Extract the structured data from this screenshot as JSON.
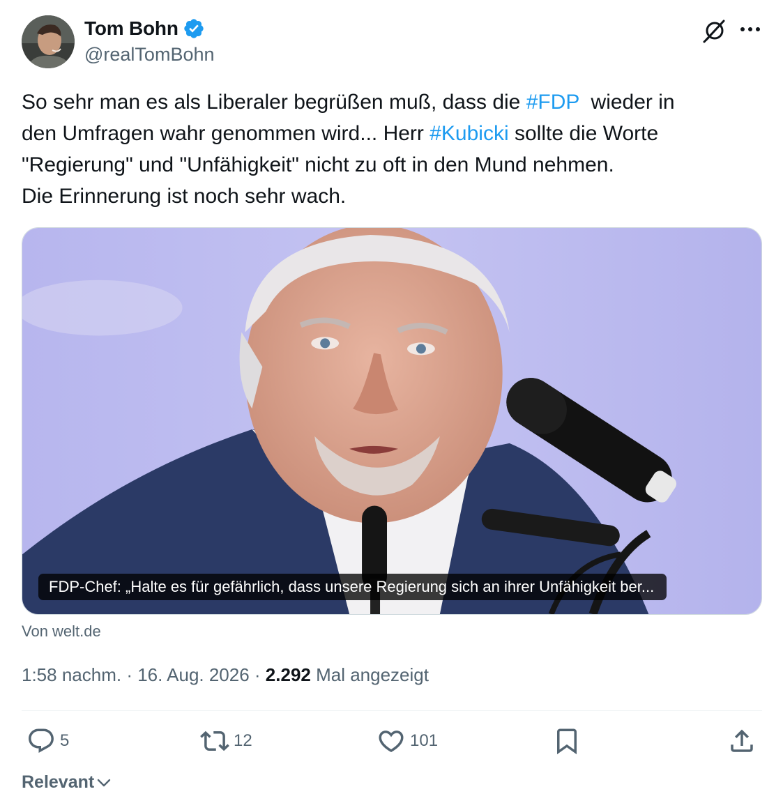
{
  "author": {
    "display_name": "Tom Bohn",
    "handle": "@realTomBohn",
    "verified_icon": "verified-badge-icon",
    "verified_color": "#1d9bf0"
  },
  "tweet": {
    "line1_a": "So sehr man es als Liberaler begrüßen muß, dass die ",
    "hashtag1": "#FDP",
    "line1_b": "  wieder in",
    "line2_a": "den Umfragen wahr genommen wird... Herr ",
    "hashtag2": "#Kubicki",
    "line2_b": " sollte die Worte",
    "line3": "\"Regierung\" und \"Unfähigkeit\" nicht zu oft in den Mund nehmen.",
    "line4": "Die Erinnerung ist noch sehr wach.",
    "hashtag_color": "#1d9bf0"
  },
  "card": {
    "title": "FDP-Chef: „Halte es für gefährlich, dass unsere Regierung sich an ihrer Unfähigkeit ber...",
    "source": "Von welt.de"
  },
  "meta": {
    "time": "1:58 nachm.",
    "sep1": " · ",
    "date": "16. Aug. 2026",
    "sep2": " · ",
    "views_count": "2.292",
    "views_label": " Mal angezeigt"
  },
  "actions": {
    "replies": "5",
    "reposts": "12",
    "likes": "101"
  },
  "sort": {
    "label": "Relevant"
  },
  "colors": {
    "text_primary": "#0f1419",
    "text_secondary": "#536471",
    "accent": "#1d9bf0"
  }
}
